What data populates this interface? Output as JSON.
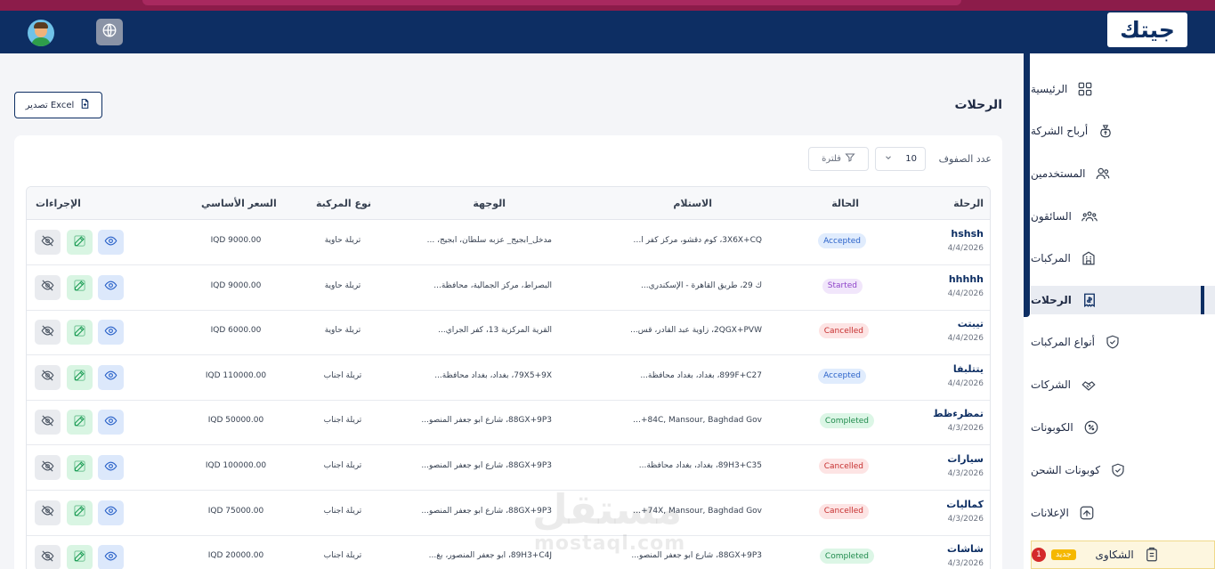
{
  "brand": {
    "logo_text": "جيتك",
    "accent": "#f5b800",
    "primary": "#0d2e63"
  },
  "sidebar": {
    "items": [
      {
        "label": "الرئيسية",
        "icon": "grid-icon",
        "active": false
      },
      {
        "label": "أرباح الشركة",
        "icon": "money-bag-icon",
        "active": false
      },
      {
        "label": "المستخدمين",
        "icon": "users-icon",
        "active": false
      },
      {
        "label": "السائقون",
        "icon": "drivers-icon",
        "active": false
      },
      {
        "label": "المركبات",
        "icon": "building-icon",
        "active": false
      },
      {
        "label": "الرحلات",
        "icon": "trip-receipt-icon",
        "active": true
      },
      {
        "label": "أنواع المركبات",
        "icon": "shield-check-icon",
        "active": false
      },
      {
        "label": "الشركات",
        "icon": "handshake-icon",
        "active": false
      },
      {
        "label": "الكوبونات",
        "icon": "discount-icon",
        "active": false
      },
      {
        "label": "كوبونات الشحن",
        "icon": "shield-check-icon",
        "active": false
      },
      {
        "label": "الإعلانات",
        "icon": "megaphone-icon",
        "active": false
      }
    ],
    "complaints": {
      "label": "الشكاوى",
      "badge_new": "جديد",
      "badge_count": "1",
      "icon": "clipboard-icon"
    }
  },
  "main": {
    "title": "الرحلات",
    "export_label": "تصدير Excel",
    "rows_label": "عدد الصفوف",
    "rows_value": "10",
    "filter_label": "فلترة"
  },
  "table": {
    "headers": {
      "trip": "الرحلة",
      "status": "الحالة",
      "pickup": "الاستلام",
      "destination": "الوجهة",
      "vehicle_type": "نوع المركبة",
      "base_price": "السعر الأساسي",
      "actions": "الإجراءات"
    },
    "rows": [
      {
        "name": "hshsh",
        "date": "4/4/2026",
        "status": "Accepted",
        "status_class": "accepted",
        "pickup": "3X6X+CQ، كوم دقشو، مركز كفر ال...",
        "destination": "مدخل_ابجيج_ عزبه سلطان، أبجيج، ...",
        "vehicle_type": "تريلة حاوية",
        "price": "IQD 9000.00"
      },
      {
        "name": "hhhhh",
        "date": "4/4/2026",
        "status": "Started",
        "status_class": "started",
        "pickup": "ك 29، طريق القاهرة - الإسكندري...",
        "destination": "البصراط، مركز الجمالية، محافظة...",
        "vehicle_type": "تريلة حاوية",
        "price": "IQD 9000.00"
      },
      {
        "name": "تيبتت",
        "date": "4/4/2026",
        "status": "Cancelled",
        "status_class": "cancelled",
        "pickup": "2QGX+PVW، زاوية عبد القادر، قس...",
        "destination": "القرية المركزية 13، كفر الجراي...",
        "vehicle_type": "تريلة حاوية",
        "price": "IQD 6000.00"
      },
      {
        "name": "يتتلبفا",
        "date": "4/4/2026",
        "status": "Accepted",
        "status_class": "accepted",
        "pickup": "899F+C27، بغداد، بغداد محافظة...",
        "destination": "79X5+9X، بغداد، بغداد محافظة...",
        "vehicle_type": "تريلة اجناب",
        "price": "IQD 110000.00"
      },
      {
        "name": "تمظرءظط",
        "date": "4/3/2026",
        "status": "Completed",
        "status_class": "completed",
        "pickup": "89H3+84C, Mansour, Baghdad Gov...",
        "destination": "88GX+9P3، شارع ابو جعفر المنصو...",
        "vehicle_type": "تريلة اجناب",
        "price": "IQD 50000.00"
      },
      {
        "name": "سيارات",
        "date": "4/3/2026",
        "status": "Cancelled",
        "status_class": "cancelled",
        "pickup": "89H3+C35، بغداد، بغداد محافظة...",
        "destination": "88GX+9P3، شارع ابو جعفر المنصو...",
        "vehicle_type": "تريلة اجناب",
        "price": "IQD 100000.00"
      },
      {
        "name": "كماليات",
        "date": "4/3/2026",
        "status": "Cancelled",
        "status_class": "cancelled",
        "pickup": "89H3+74X, Mansour, Baghdad Gov...",
        "destination": "88GX+9P3، شارع ابو جعفر المنصو...",
        "vehicle_type": "تريلة اجناب",
        "price": "IQD 75000.00"
      },
      {
        "name": "شاشات",
        "date": "4/3/2026",
        "status": "Completed",
        "status_class": "completed",
        "pickup": "88GX+9P3، شارع ابو جعفر المنصو...",
        "destination": "89H3+C4J، ابو جعفر المنصور، بغ...",
        "vehicle_type": "تريلة اجناب",
        "price": "IQD 20000.00"
      }
    ]
  },
  "watermark": {
    "line1": "مستقل",
    "line2": "mostaql.com"
  }
}
